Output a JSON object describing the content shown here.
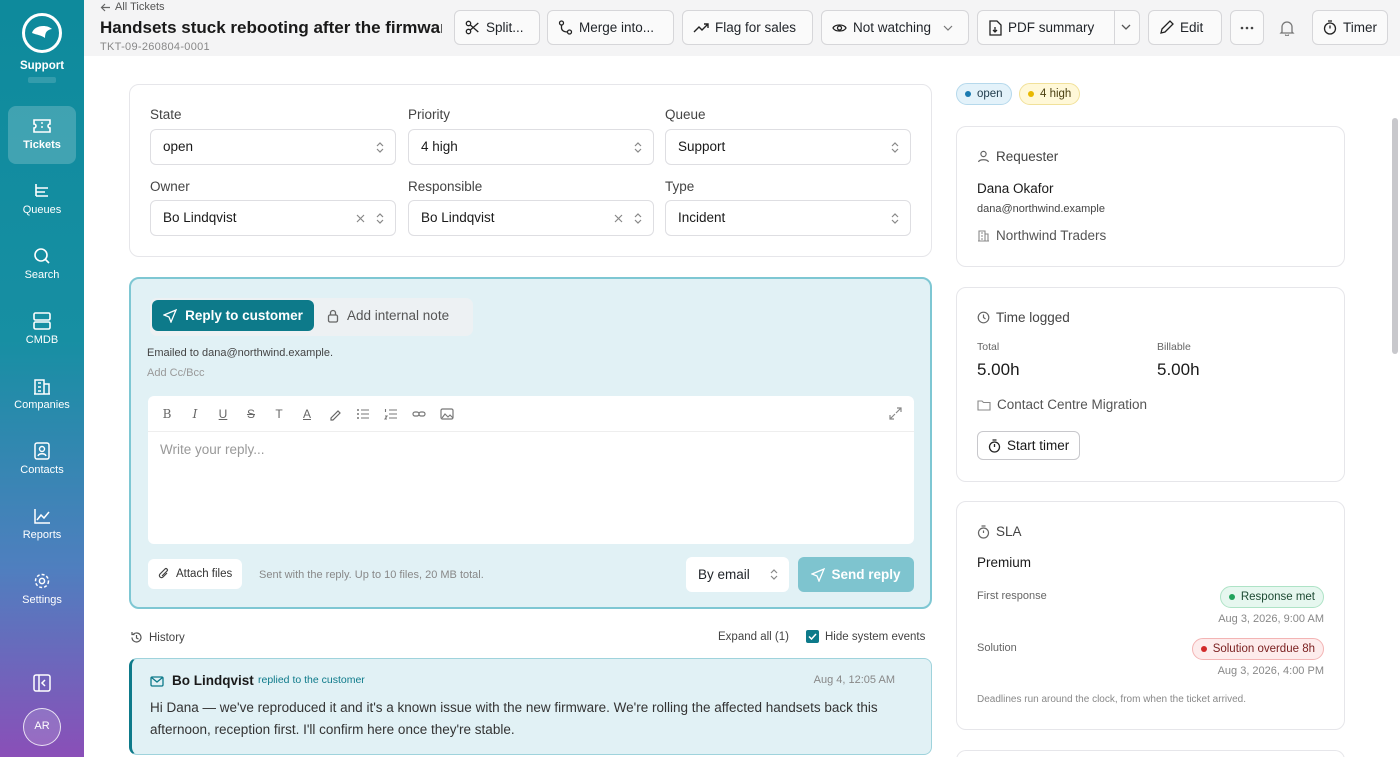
{
  "sidebar": {
    "brand": "Support",
    "items": [
      {
        "label": "Tickets",
        "icon": "ticket-icon"
      },
      {
        "label": "Queues",
        "icon": "list-tree-icon"
      },
      {
        "label": "Search",
        "icon": "search-icon"
      },
      {
        "label": "CMDB",
        "icon": "server-icon"
      },
      {
        "label": "Companies",
        "icon": "building-icon"
      },
      {
        "label": "Contacts",
        "icon": "contact-icon"
      },
      {
        "label": "Reports",
        "icon": "chart-icon"
      },
      {
        "label": "Settings",
        "icon": "gear-icon"
      }
    ],
    "active": "Tickets",
    "avatar": "AR"
  },
  "header": {
    "back_link": "All Tickets",
    "title": "Handsets stuck rebooting after the firmware update",
    "ticket_id": "TKT-09-260804-0001",
    "buttons": {
      "split": "Split...",
      "merge": "Merge into...",
      "flag": "Flag for sales",
      "watch": "Not watching",
      "pdf": "PDF summary",
      "edit": "Edit",
      "timer": "Timer"
    }
  },
  "fields": {
    "state": {
      "label": "State",
      "value": "open"
    },
    "priority": {
      "label": "Priority",
      "value": "4 high"
    },
    "queue": {
      "label": "Queue",
      "value": "Support"
    },
    "owner": {
      "label": "Owner",
      "value": "Bo Lindqvist"
    },
    "responsible": {
      "label": "Responsible",
      "value": "Bo Lindqvist"
    },
    "type": {
      "label": "Type",
      "value": "Incident"
    }
  },
  "reply": {
    "tab_reply": "Reply to customer",
    "tab_note": "Add internal note",
    "emailed_to": "Emailed to dana@northwind.example.",
    "add_cc": "Add Cc/Bcc",
    "placeholder": "Write your reply...",
    "attach": "Attach files",
    "attach_hint": "Sent with the reply. Up to 10 files, 20 MB total.",
    "channel": "By email",
    "send": "Send reply"
  },
  "history": {
    "label": "History",
    "expand_all": "Expand all (1)",
    "hide_system": "Hide system events",
    "messages": [
      {
        "author": "Bo Lindqvist",
        "action": "replied to the customer",
        "time": "Aug 4, 12:05 AM",
        "body": "Hi Dana — we've reproduced it and it's a known issue with the new firmware. We're rolling the affected handsets back this afternoon, reception first. I'll confirm here once they're stable."
      }
    ]
  },
  "badges": {
    "state": "open",
    "priority": "4 high"
  },
  "requester": {
    "title": "Requester",
    "name": "Dana Okafor",
    "email": "dana@northwind.example",
    "company": "Northwind Traders"
  },
  "time_logged": {
    "title": "Time logged",
    "total_label": "Total",
    "total": "5.00h",
    "billable_label": "Billable",
    "billable": "5.00h",
    "project": "Contact Centre Migration",
    "start_timer": "Start timer"
  },
  "sla": {
    "title": "SLA",
    "tier": "Premium",
    "first_response_label": "First response",
    "first_response_status": "Response met",
    "first_response_date": "Aug 3, 2026, 9:00 AM",
    "solution_label": "Solution",
    "solution_status": "Solution overdue 8h",
    "solution_date": "Aug 3, 2026, 4:00 PM",
    "note": "Deadlines run around the clock, from when the ticket arrived."
  },
  "colors": {
    "accent": "#0d7a8a",
    "met": "#21a35c",
    "overdue": "#d12a2a"
  }
}
